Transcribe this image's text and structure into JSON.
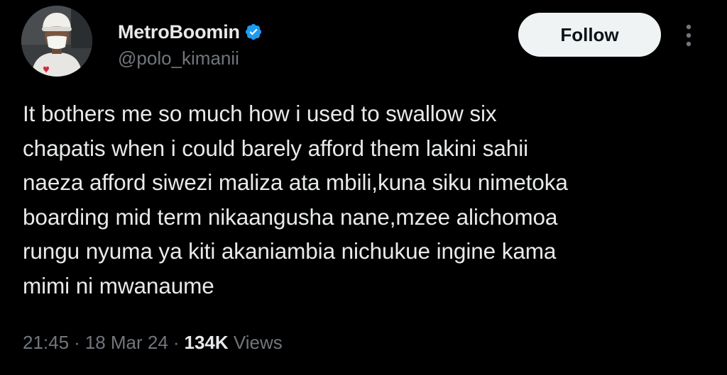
{
  "user": {
    "display_name": "MetroBoomin",
    "handle": "@polo_kimanii",
    "verified": true,
    "verified_color": "#1d9bf0"
  },
  "actions": {
    "follow_label": "Follow",
    "more_icon": "more-vertical-icon"
  },
  "tweet": {
    "text": "It bothers me so much how i used to swallow six\nchapatis when i could barely afford them lakini sahii\nnaeza afford siwezi maliza ata mbili,kuna siku nimetoka\nboarding mid term nikaangusha nane,mzee alichomoa\nrungu nyuma ya kiti akaniambia nichukue ingine kama\nmimi ni mwanaume"
  },
  "meta": {
    "time": "21:45",
    "separator": "·",
    "date": "18 Mar 24",
    "views_count": "134K",
    "views_label": "Views"
  },
  "colors": {
    "background": "#000000",
    "text_primary": "#e7e9ea",
    "text_secondary": "#71767b",
    "button_bg": "#eff3f4",
    "button_text": "#0f1419"
  }
}
